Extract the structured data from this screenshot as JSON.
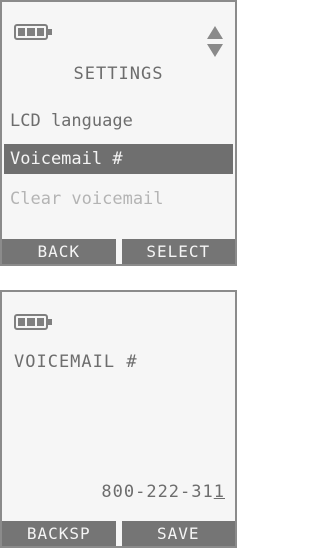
{
  "screen1": {
    "title": "SETTINGS",
    "menu_items": [
      "LCD language",
      "Voicemail #",
      "Clear voicemail"
    ],
    "selected_index": 1,
    "softkeys": {
      "left": "BACK",
      "right": "SELECT"
    }
  },
  "screen2": {
    "title": "VOICEMAIL #",
    "number_prefix": "800-222-31",
    "number_cursor_char": "1",
    "softkeys": {
      "left": "BACKSP",
      "right": "SAVE"
    }
  },
  "icons": {
    "battery": "battery-icon",
    "scroll": "up-down-arrow-icon"
  },
  "colors": {
    "lcd_background": "#f6f6f6",
    "text": "#6d6d6d",
    "highlight_bg": "#6f6f6f",
    "highlight_text": "#f4f4f4",
    "softkey_bg": "#757575",
    "dim_text": "#b4b4b4"
  }
}
